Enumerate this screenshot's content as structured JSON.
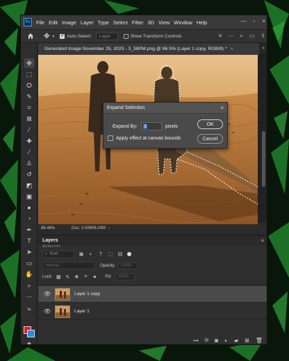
{
  "menu": {
    "logo": "Ps",
    "items": [
      "File",
      "Edit",
      "Image",
      "Layer",
      "Type",
      "Select",
      "Filter",
      "3D",
      "View",
      "Window",
      "Help"
    ]
  },
  "options_bar": {
    "auto_select_label": "Auto-Select:",
    "auto_select_target": "Layer",
    "transform_label": "Show Transform Controls"
  },
  "document": {
    "tab_title": "Generated Image November 25, 2025 - 3_58PM.png @ 86.5% (Layer 1 copy, RGB/8) *",
    "tab_close": "×",
    "zoom": "86.46%",
    "doc_size": "Doc: 3.00M/6.00M"
  },
  "dialog": {
    "title": "Expand Selection",
    "close": "×",
    "expand_label": "Expand By:",
    "expand_value": "3",
    "unit": "pixels",
    "canvas_bounds_label": "Apply effect at canvas bounds",
    "ok_label": "OK",
    "cancel_label": "Cancel"
  },
  "layers_panel": {
    "title": "Layers",
    "subtitle": "@CREATIFY",
    "kind_label": "Kind",
    "blend_mode": "Normal",
    "opacity_label": "Opacity:",
    "opacity_value": "100%",
    "lock_label": "Lock:",
    "fill_label": "Fill:",
    "fill_value": "100%",
    "layers": [
      {
        "name": "Layer 1 copy",
        "selected": true
      },
      {
        "name": "Layer 1",
        "selected": false
      }
    ]
  },
  "colors": {
    "foreground": "#e11b1b",
    "background": "#2a89e8",
    "accent": "#31a8ff"
  }
}
